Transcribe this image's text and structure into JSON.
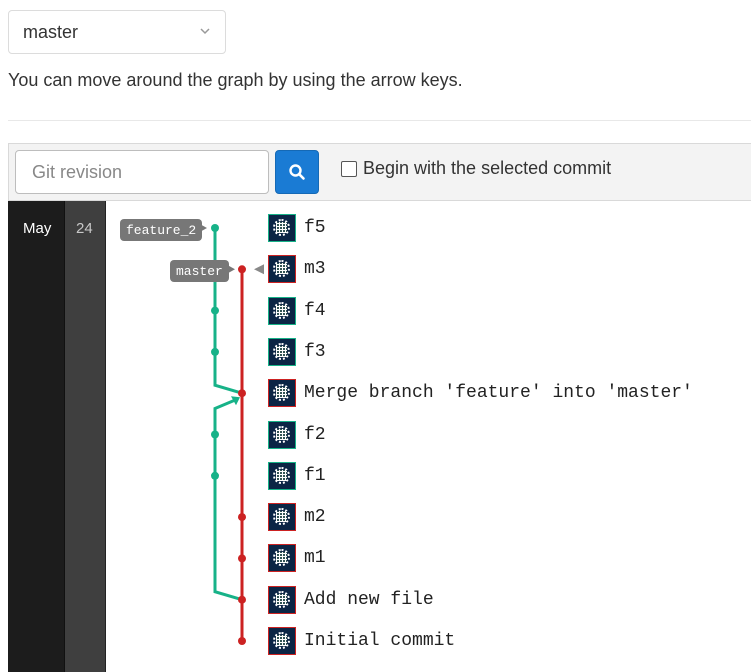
{
  "branch_select": {
    "value": "master",
    "icon": "chevron-down-icon"
  },
  "hint": "You can move around the graph by using the arrow keys.",
  "toolbar": {
    "revision_placeholder": "Git revision",
    "search_icon": "search-icon",
    "begin_checkbox_label": "Begin with the selected commit",
    "begin_checked": false
  },
  "date_column": {
    "month": "May",
    "day": "24"
  },
  "refs": [
    {
      "label": "feature_2",
      "commit": "f5"
    },
    {
      "label": "master",
      "commit": "m3"
    }
  ],
  "commits": [
    {
      "message": "f5",
      "branch": "feature",
      "color": "#17b288"
    },
    {
      "message": "m3",
      "branch": "master",
      "color": "#cc2222"
    },
    {
      "message": "f4",
      "branch": "feature",
      "color": "#17b288"
    },
    {
      "message": "f3",
      "branch": "feature",
      "color": "#17b288"
    },
    {
      "message": "Merge branch 'feature' into 'master'",
      "branch": "master",
      "color": "#cc2222"
    },
    {
      "message": "f2",
      "branch": "feature",
      "color": "#17b288"
    },
    {
      "message": "f1",
      "branch": "feature",
      "color": "#17b288"
    },
    {
      "message": "m2",
      "branch": "master",
      "color": "#cc2222"
    },
    {
      "message": "m1",
      "branch": "master",
      "color": "#cc2222"
    },
    {
      "message": "Add new file",
      "branch": "master",
      "color": "#cc2222"
    },
    {
      "message": "Initial commit",
      "branch": "master",
      "color": "#cc2222"
    }
  ],
  "colors": {
    "feature": "#17b288",
    "master": "#cc2222",
    "accent": "#1a7bd4"
  }
}
